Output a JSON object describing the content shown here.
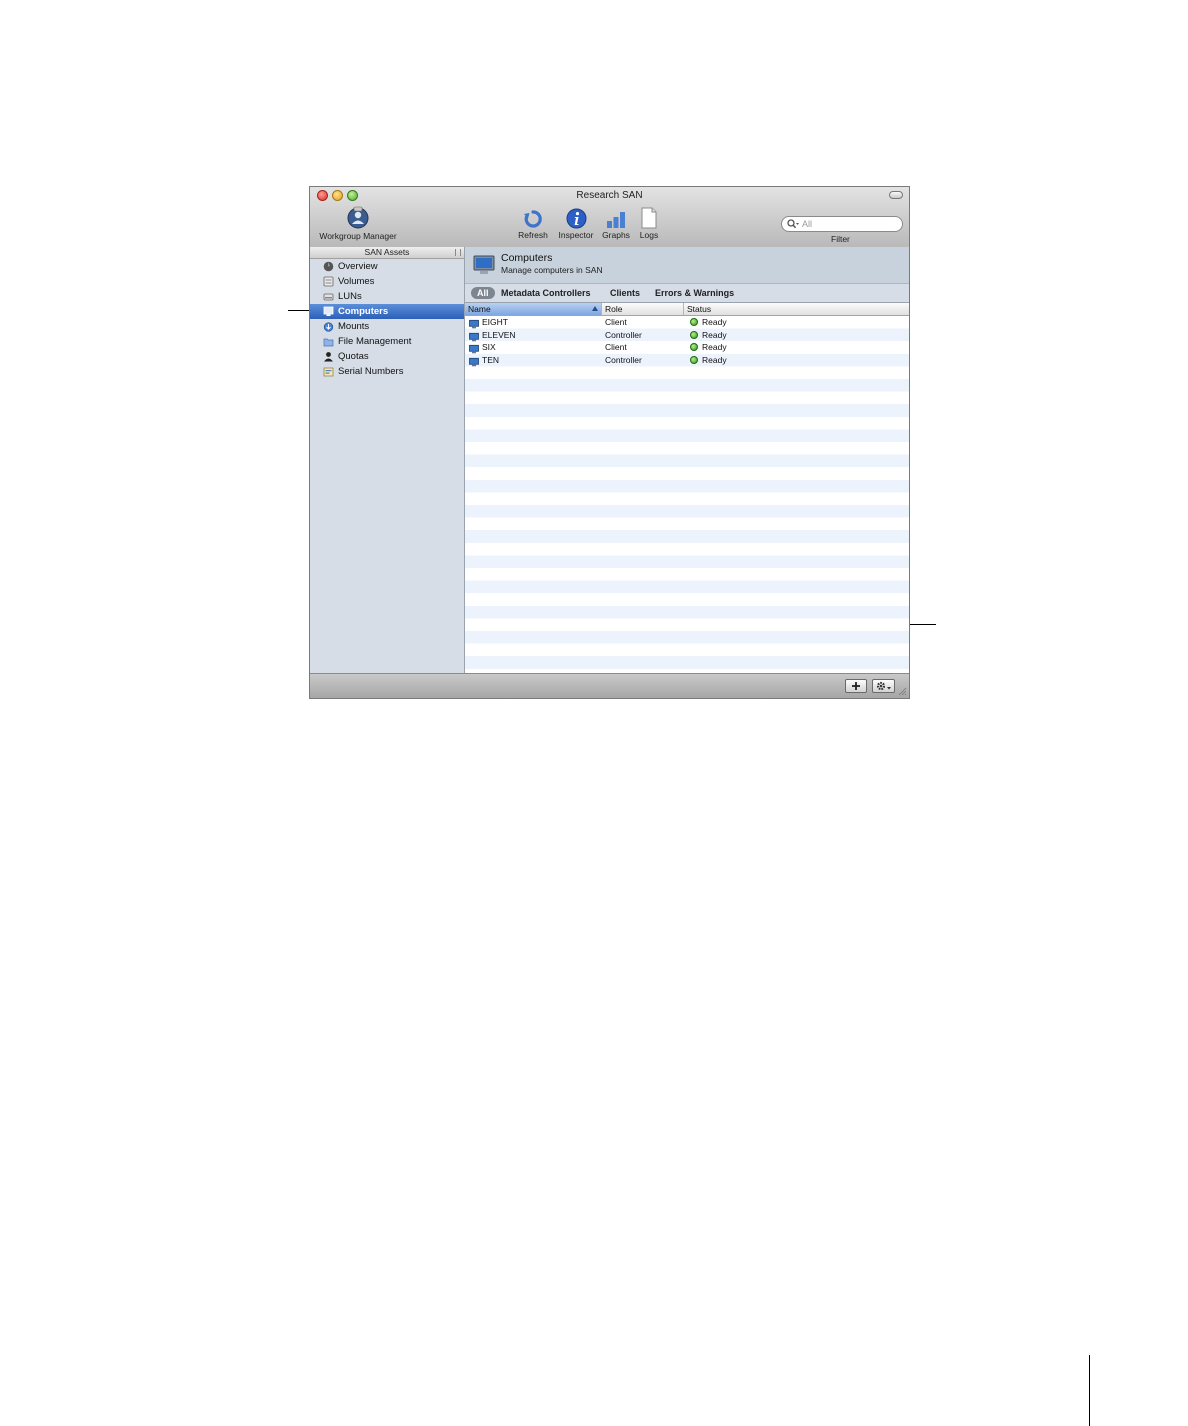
{
  "window": {
    "title": "Research SAN"
  },
  "toolbar": {
    "workgroup_manager_label": "Workgroup Manager",
    "refresh_label": "Refresh",
    "inspector_label": "Inspector",
    "graphs_label": "Graphs",
    "logs_label": "Logs",
    "search_placeholder": "All",
    "filter_label": "Filter"
  },
  "sidebar": {
    "header": "SAN Assets",
    "items": [
      {
        "label": "Overview",
        "icon": "overview-icon"
      },
      {
        "label": "Volumes",
        "icon": "volume-icon"
      },
      {
        "label": "LUNs",
        "icon": "lun-icon"
      },
      {
        "label": "Computers",
        "icon": "computer-icon",
        "selected": true
      },
      {
        "label": "Mounts",
        "icon": "mount-icon"
      },
      {
        "label": "File Management",
        "icon": "folder-icon"
      },
      {
        "label": "Quotas",
        "icon": "quota-icon"
      },
      {
        "label": "Serial Numbers",
        "icon": "serial-number-icon"
      }
    ]
  },
  "main": {
    "header_title": "Computers",
    "header_subtitle": "Manage computers in SAN",
    "scopes": [
      "All",
      "Metadata Controllers",
      "Clients",
      "Errors & Warnings"
    ],
    "columns": [
      "Name",
      "Role",
      "Status"
    ],
    "rows": [
      {
        "name": "EIGHT",
        "role": "Client",
        "status": "Ready"
      },
      {
        "name": "ELEVEN",
        "role": "Controller",
        "status": "Ready"
      },
      {
        "name": "SIX",
        "role": "Client",
        "status": "Ready"
      },
      {
        "name": "TEN",
        "role": "Controller",
        "status": "Ready"
      }
    ]
  },
  "colors": {
    "selection": "#2c5fb8",
    "status_ready": "#2e9a1c",
    "row_alt": "#edf3fc"
  }
}
